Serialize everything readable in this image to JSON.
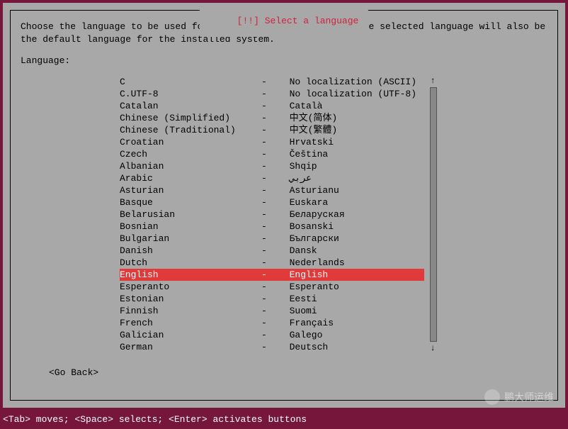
{
  "dialog": {
    "title_prefix": "[!!] ",
    "title": "Select a language",
    "instructions": "Choose the language to be used for the installation process. The selected language will also be the default language for the installed system.",
    "field_label": "Language:",
    "back_label": "<Go Back>"
  },
  "languages": [
    {
      "name": "C",
      "native": "No localization (ASCII)",
      "selected": false
    },
    {
      "name": "C.UTF-8",
      "native": "No localization (UTF-8)",
      "selected": false
    },
    {
      "name": "Catalan",
      "native": "Català",
      "selected": false
    },
    {
      "name": "Chinese (Simplified)",
      "native": "中文(简体)",
      "selected": false
    },
    {
      "name": "Chinese (Traditional)",
      "native": "中文(繁體)",
      "selected": false
    },
    {
      "name": "Croatian",
      "native": "Hrvatski",
      "selected": false
    },
    {
      "name": "Czech",
      "native": "Čeština",
      "selected": false
    },
    {
      "name": "Albanian",
      "native": "Shqip",
      "selected": false
    },
    {
      "name": "Arabic",
      "native": "عربي",
      "selected": false
    },
    {
      "name": "Asturian",
      "native": "Asturianu",
      "selected": false
    },
    {
      "name": "Basque",
      "native": "Euskara",
      "selected": false
    },
    {
      "name": "Belarusian",
      "native": "Беларуская",
      "selected": false
    },
    {
      "name": "Bosnian",
      "native": "Bosanski",
      "selected": false
    },
    {
      "name": "Bulgarian",
      "native": "Български",
      "selected": false
    },
    {
      "name": "Danish",
      "native": "Dansk",
      "selected": false
    },
    {
      "name": "Dutch",
      "native": "Nederlands",
      "selected": false
    },
    {
      "name": "English",
      "native": "English",
      "selected": true
    },
    {
      "name": "Esperanto",
      "native": "Esperanto",
      "selected": false
    },
    {
      "name": "Estonian",
      "native": "Eesti",
      "selected": false
    },
    {
      "name": "Finnish",
      "native": "Suomi",
      "selected": false
    },
    {
      "name": "French",
      "native": "Français",
      "selected": false
    },
    {
      "name": "Galician",
      "native": "Galego",
      "selected": false
    },
    {
      "name": "German",
      "native": "Deutsch",
      "selected": false
    }
  ],
  "scroll": {
    "up_glyph": "↑",
    "down_glyph": "↓"
  },
  "footer": "<Tab> moves; <Space> selects; <Enter> activates buttons",
  "watermark": "鹏大师运维"
}
